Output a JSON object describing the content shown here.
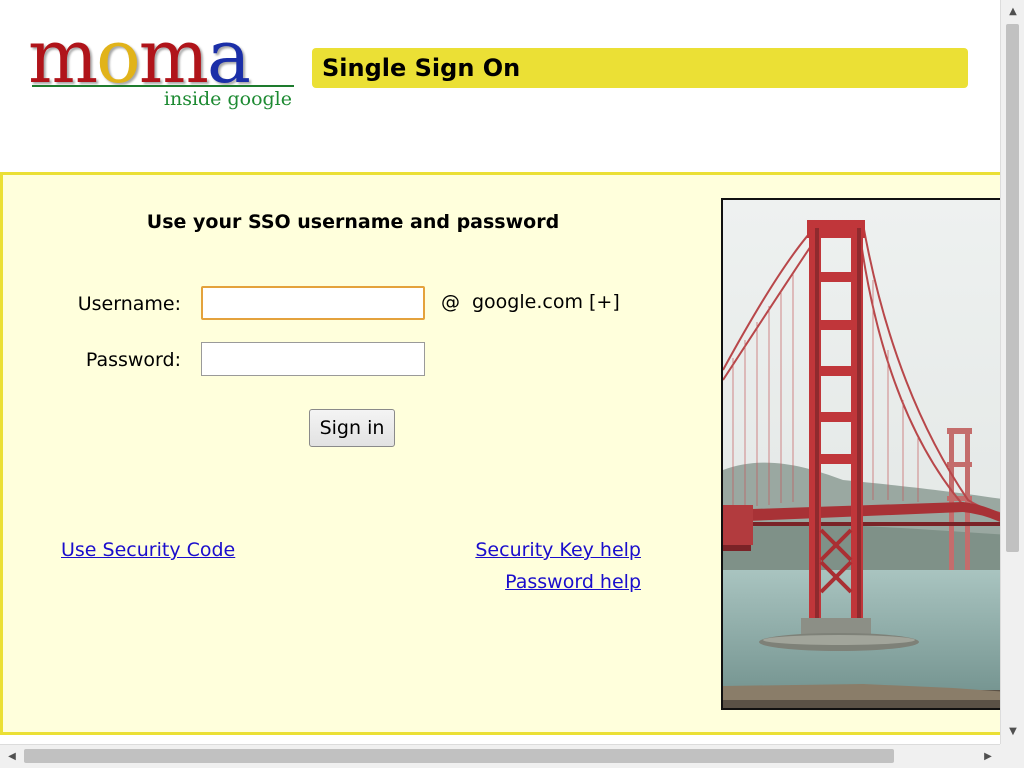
{
  "header": {
    "logo": {
      "text": "moma",
      "letters": [
        "m",
        "o",
        "m",
        "a"
      ],
      "tagline": "inside google",
      "colors": [
        "#b0141a",
        "#e1b31a",
        "#b0141a",
        "#1b2fa8"
      ],
      "tagline_color": "#1d8a32"
    },
    "title": "Single Sign On",
    "title_bar_color": "#ebe035"
  },
  "form": {
    "heading": "Use your SSO username and password",
    "username": {
      "label": "Username:",
      "value": "",
      "focused": true
    },
    "domain": {
      "at": "@",
      "name": "google.com",
      "expand": "[+]"
    },
    "password": {
      "label": "Password:",
      "value": ""
    },
    "submit_label": "Sign in",
    "panel_background": "#ffffdc"
  },
  "links": {
    "security_code": "Use Security Code",
    "security_key_help": "Security Key help",
    "password_help": "Password help",
    "color": "#1a0dcc"
  },
  "photo": {
    "icon": "golden-gate-bridge-photo",
    "bridge_color": "#c0363a"
  },
  "scrollbars": {
    "vertical": {
      "up_icon": "▲",
      "down_icon": "▼"
    },
    "horizontal": {
      "left_icon": "◀",
      "right_icon": "▶"
    }
  }
}
